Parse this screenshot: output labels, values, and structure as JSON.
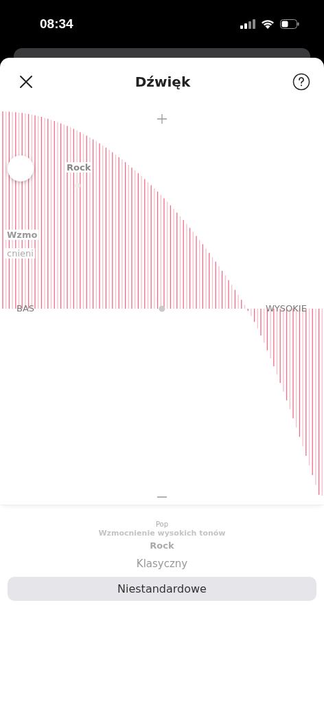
{
  "status_bar": {
    "time": "08:34"
  },
  "header": {
    "title": "Dźwięk"
  },
  "equalizer": {
    "bass_label": "BAS",
    "treble_label": "WYSOKIE",
    "preset_label": "Rock",
    "side_label_lines": [
      "Wzmo",
      "cnieni"
    ]
  },
  "presets": [
    {
      "label": "Pop",
      "selected": false
    },
    {
      "label": "Wzmocnienie wysokich tonów",
      "selected": false
    },
    {
      "label": "Rock",
      "selected": false
    },
    {
      "label": "Klasyczny",
      "selected": false
    },
    {
      "label": "Niestandardowe",
      "selected": true
    }
  ]
}
